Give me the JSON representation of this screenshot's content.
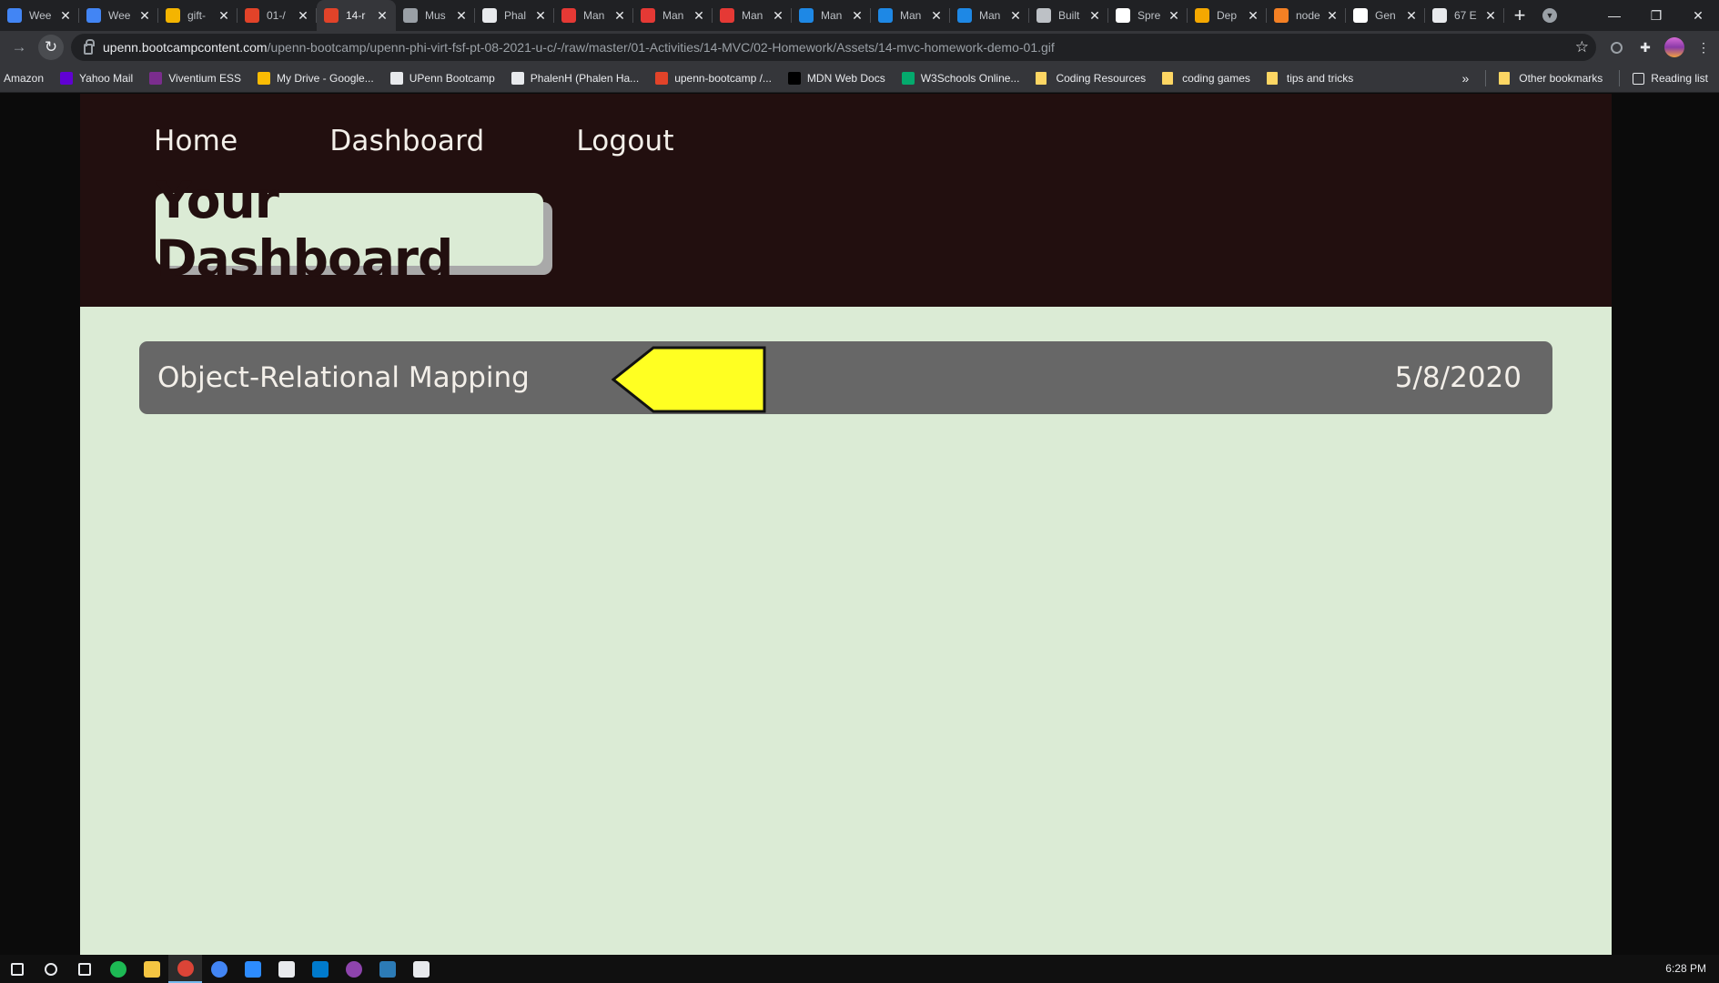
{
  "browser": {
    "tabs": [
      {
        "title": "Wee",
        "color": "#4285f4",
        "active": false
      },
      {
        "title": "Wee",
        "color": "#4285f4",
        "active": false
      },
      {
        "title": "gift-",
        "color": "#f4b400",
        "active": false
      },
      {
        "title": "01-/",
        "color": "#e24329",
        "active": false
      },
      {
        "title": "14-r",
        "color": "#e24329",
        "active": true
      },
      {
        "title": "Mus",
        "color": "#9aa0a6",
        "active": false
      },
      {
        "title": "Phal",
        "color": "#e8eaed",
        "active": false
      },
      {
        "title": "Man",
        "color": "#e53935",
        "active": false
      },
      {
        "title": "Man",
        "color": "#e53935",
        "active": false
      },
      {
        "title": "Man",
        "color": "#e53935",
        "active": false
      },
      {
        "title": "Man",
        "color": "#1e88e5",
        "active": false
      },
      {
        "title": "Man",
        "color": "#1e88e5",
        "active": false
      },
      {
        "title": "Man",
        "color": "#1e88e5",
        "active": false
      },
      {
        "title": "Built",
        "color": "#bdc1c6",
        "active": false
      },
      {
        "title": "Spre",
        "color": "#ffffff",
        "active": false
      },
      {
        "title": "Dep",
        "color": "#f5a800",
        "active": false
      },
      {
        "title": "node",
        "color": "#f48024",
        "active": false
      },
      {
        "title": "Gen",
        "color": "#ffffff",
        "active": false
      },
      {
        "title": "67 E",
        "color": "#e8eaed",
        "active": false
      }
    ],
    "new_tab": "+",
    "close_glyph": "✕",
    "url_host": "upenn.bootcampcontent.com",
    "url_path": "/upenn-bootcamp/upenn-phi-virt-fsf-pt-08-2021-u-c/-/raw/master/01-Activities/14-MVC/02-Homework/Assets/14-mvc-homework-demo-01.gif",
    "bookmarks": [
      {
        "label": "Amazon",
        "color": "",
        "type": "text"
      },
      {
        "label": "Yahoo Mail",
        "color": "#6001d2",
        "type": "icon"
      },
      {
        "label": "Viventium ESS",
        "color": "#7b2d8e",
        "type": "icon"
      },
      {
        "label": "My Drive - Google...",
        "color": "#fbbc04",
        "type": "icon"
      },
      {
        "label": "UPenn Bootcamp",
        "color": "#e8eaed",
        "type": "icon"
      },
      {
        "label": "PhalenH (Phalen Ha...",
        "color": "#e8eaed",
        "type": "icon"
      },
      {
        "label": "upenn-bootcamp /...",
        "color": "#e24329",
        "type": "icon"
      },
      {
        "label": "MDN Web Docs",
        "color": "#000000",
        "type": "icon"
      },
      {
        "label": "W3Schools Online...",
        "color": "#04aa6d",
        "type": "icon"
      },
      {
        "label": "Coding Resources",
        "color": "#fdd663",
        "type": "folder"
      },
      {
        "label": "coding games",
        "color": "#fdd663",
        "type": "folder"
      },
      {
        "label": "tips and tricks",
        "color": "#fdd663",
        "type": "folder"
      }
    ],
    "more_bookmarks": "»",
    "other_bookmarks": "Other bookmarks",
    "reading_list": "Reading list"
  },
  "site": {
    "nav": [
      "Home",
      "Dashboard",
      "Logout"
    ],
    "title": "Your Dashboard",
    "posts": [
      {
        "title": "Object-Relational Mapping",
        "date": "5/8/2020"
      }
    ],
    "colors": {
      "header_bg": "#220f0f",
      "page_bg": "#dbebd5",
      "row_bg": "#676767",
      "pointer": "#ffff22"
    }
  },
  "taskbar": {
    "apps": [
      {
        "name": "search-icon",
        "color": "#e8eaed"
      },
      {
        "name": "cortana-icon",
        "color": "#e8eaed"
      },
      {
        "name": "task-view-icon",
        "color": "#e8eaed"
      },
      {
        "name": "spotify-icon",
        "color": "#1db954"
      },
      {
        "name": "file-explorer-icon",
        "color": "#f4c542"
      },
      {
        "name": "chrome-icon",
        "color": "#db4437"
      },
      {
        "name": "chrome-profile-icon",
        "color": "#4285f4"
      },
      {
        "name": "zoom-icon",
        "color": "#2d8cff"
      },
      {
        "name": "slack-icon",
        "color": "#e8eaed"
      },
      {
        "name": "vscode-icon",
        "color": "#007acc"
      },
      {
        "name": "app-icon",
        "color": "#8e44ad"
      },
      {
        "name": "app-icon",
        "color": "#2c7bb6"
      },
      {
        "name": "settings-icon",
        "color": "#e8eaed"
      }
    ],
    "active_index": 5,
    "clock": "6:28 PM"
  }
}
